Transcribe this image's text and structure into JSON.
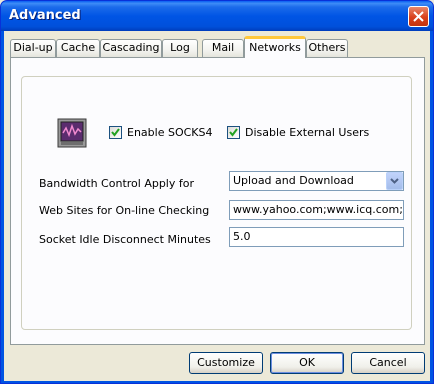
{
  "window": {
    "title": "Advanced"
  },
  "tabs": [
    {
      "label": "Dial-up"
    },
    {
      "label": "Cache"
    },
    {
      "label": "Cascading"
    },
    {
      "label": "Log"
    },
    {
      "label": "Mail"
    },
    {
      "label": "Networks",
      "active": true
    },
    {
      "label": "Others"
    }
  ],
  "networks": {
    "enable_socks4": {
      "label": "Enable SOCKS4",
      "checked": true
    },
    "disable_external_users": {
      "label": "Disable External Users",
      "checked": true
    },
    "bandwidth": {
      "label": "Bandwidth Control Apply for",
      "value": "Upload and Download"
    },
    "websites": {
      "label": "Web Sites for On-line Checking",
      "value": "www.yahoo.com;www.icq.com;www"
    },
    "idle": {
      "label": "Socket Idle Disconnect Minutes",
      "value": "5.0"
    }
  },
  "buttons": {
    "customize": "Customize",
    "ok": "OK",
    "cancel": "Cancel"
  },
  "colors": {
    "titlebar": "#0054E3",
    "active_tab_accent": "#FFC83C",
    "dialog_bg": "#ECE9D8"
  }
}
